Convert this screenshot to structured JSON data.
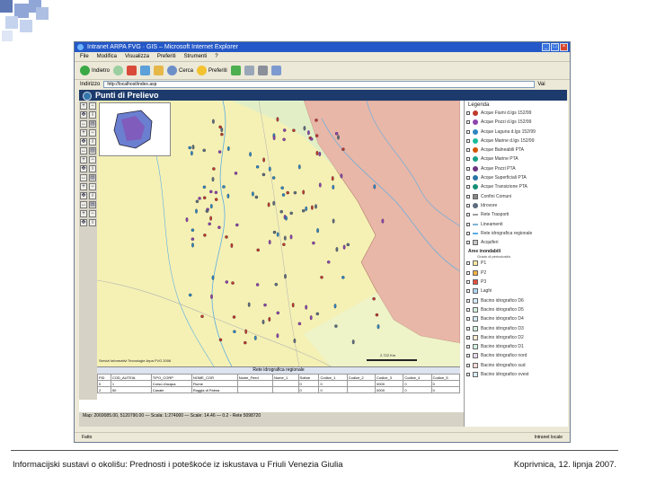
{
  "decor": {
    "square_color": "#8fa6d7",
    "square_color_dark": "#5d76b4"
  },
  "window": {
    "title": "Intranet ARPA FVG · GIS – Microsoft Internet Explorer",
    "menu": [
      "File",
      "Modifica",
      "Visualizza",
      "Preferiti",
      "Strumenti",
      "?"
    ],
    "toolbar": [
      "Indietro",
      "Cerca",
      "Preferiti"
    ],
    "address_label": "Indirizzo",
    "address_value": "http://localhost/index.asp",
    "go_label": "Vai",
    "status_left": "Fatto",
    "status_zone": "Intranet locale"
  },
  "app": {
    "title": "Punti di Prelievo",
    "tool_icons": [
      "zoom-in-icon",
      "zoom-out-icon",
      "pan-icon",
      "info-icon",
      "measure-icon",
      "print-icon"
    ],
    "map_credit": "Servizi informativi Tecnologie Arpa FVG 2006",
    "scale_label": "2.722 Km",
    "status_text": "Map: 2069085.00, 5120790.00 — Scala: 1:274000 — Scale: 14.46 — 0.2 - Rete 5098720",
    "table": {
      "title": "Rete idrografica regionale",
      "headers": [
        "FID",
        "COD_AUTEIA",
        "TIPO_CORP",
        "NOME_COR",
        "Nome_Feed",
        "Nome_1",
        "Sottoe",
        "Codice_1",
        "Codice_2",
        "Codice_3",
        "Codice_4",
        "Codice_5"
      ],
      "rows": [
        [
          "0",
          "1",
          "Corso d'acqua",
          "Fiume",
          "",
          "",
          "0",
          "0",
          "",
          "0000",
          "0",
          "0"
        ],
        [
          "2",
          "50",
          "Canale",
          "Roggia di Palma",
          "",
          "",
          "0",
          "0",
          "",
          "0000",
          "0",
          "0"
        ]
      ]
    }
  },
  "legend": {
    "title": "Legenda",
    "items": [
      {
        "label": "Acque Fiumi d.lgs 152/99",
        "color": "#c0392b",
        "shape": "circle"
      },
      {
        "label": "Acque Pozzi d.lgs 152/99",
        "color": "#8e44ad",
        "shape": "circle"
      },
      {
        "label": "Acque Laguna d.lgs 152/99",
        "color": "#2e86c1",
        "shape": "circle"
      },
      {
        "label": "Acque Marine d.lgs 152/99",
        "color": "#1abc9c",
        "shape": "circle"
      },
      {
        "label": "Acque Balneabili PTA",
        "color": "#d35400",
        "shape": "circle"
      },
      {
        "label": "Acque Marine PTA",
        "color": "#16a085",
        "shape": "circle"
      },
      {
        "label": "Acque Pozzi PTA",
        "color": "#6c3483",
        "shape": "circle"
      },
      {
        "label": "Acque Superficiali PTA",
        "color": "#2874a6",
        "shape": "circle"
      },
      {
        "label": "Acque Transizione PTA",
        "color": "#148f77",
        "shape": "circle"
      },
      {
        "label": "Confini Comuni",
        "color": "#888888",
        "shape": "square"
      },
      {
        "label": "Idrovore",
        "color": "#5d6d7e",
        "shape": "circle"
      },
      {
        "label": "Rete Trasporti",
        "color": "#a0a0a0",
        "shape": "line"
      },
      {
        "label": "Lineamenti",
        "color": "#7fb3d5",
        "shape": "line"
      },
      {
        "label": "Rete idrografica regionale",
        "color": "#5dade2",
        "shape": "line"
      },
      {
        "label": "Acquiferi",
        "color": "#c8c8c8",
        "shape": "square"
      }
    ],
    "section_title": "Aree inondabili",
    "section_sub": "Grado di pericolosità",
    "flood_items": [
      {
        "label": "P1",
        "color": "#f9e79f"
      },
      {
        "label": "P2",
        "color": "#f5b041"
      },
      {
        "label": "P3",
        "color": "#e74c3c"
      },
      {
        "label": "Laghi",
        "color": "#aed6f1"
      },
      {
        "label": "Bacino idrografico D6",
        "color": "#d6eaf8"
      },
      {
        "label": "Bacino idrografico D5",
        "color": "#d4efdf"
      },
      {
        "label": "Bacino idrografico D4",
        "color": "#d6eaf8"
      },
      {
        "label": "Bacino idrografico D3",
        "color": "#d4efdf"
      },
      {
        "label": "Bacino idrografico D2",
        "color": "#fdebd0"
      },
      {
        "label": "Bacino idrografico D1",
        "color": "#d5f5e3"
      },
      {
        "label": "Bacino idrografico nord",
        "color": "#e8daef"
      },
      {
        "label": "Bacino idrografico sud",
        "color": "#fadbd8"
      },
      {
        "label": "Bacino idrografico ovest",
        "color": "#d6eaf8"
      }
    ]
  },
  "footer": {
    "left": "Informacijski sustavi o okolišu: Prednosti i poteškoće iz iskustava u Friuli Venezia Giulia",
    "right": "Koprivnica, 12. lipnja 2007."
  }
}
